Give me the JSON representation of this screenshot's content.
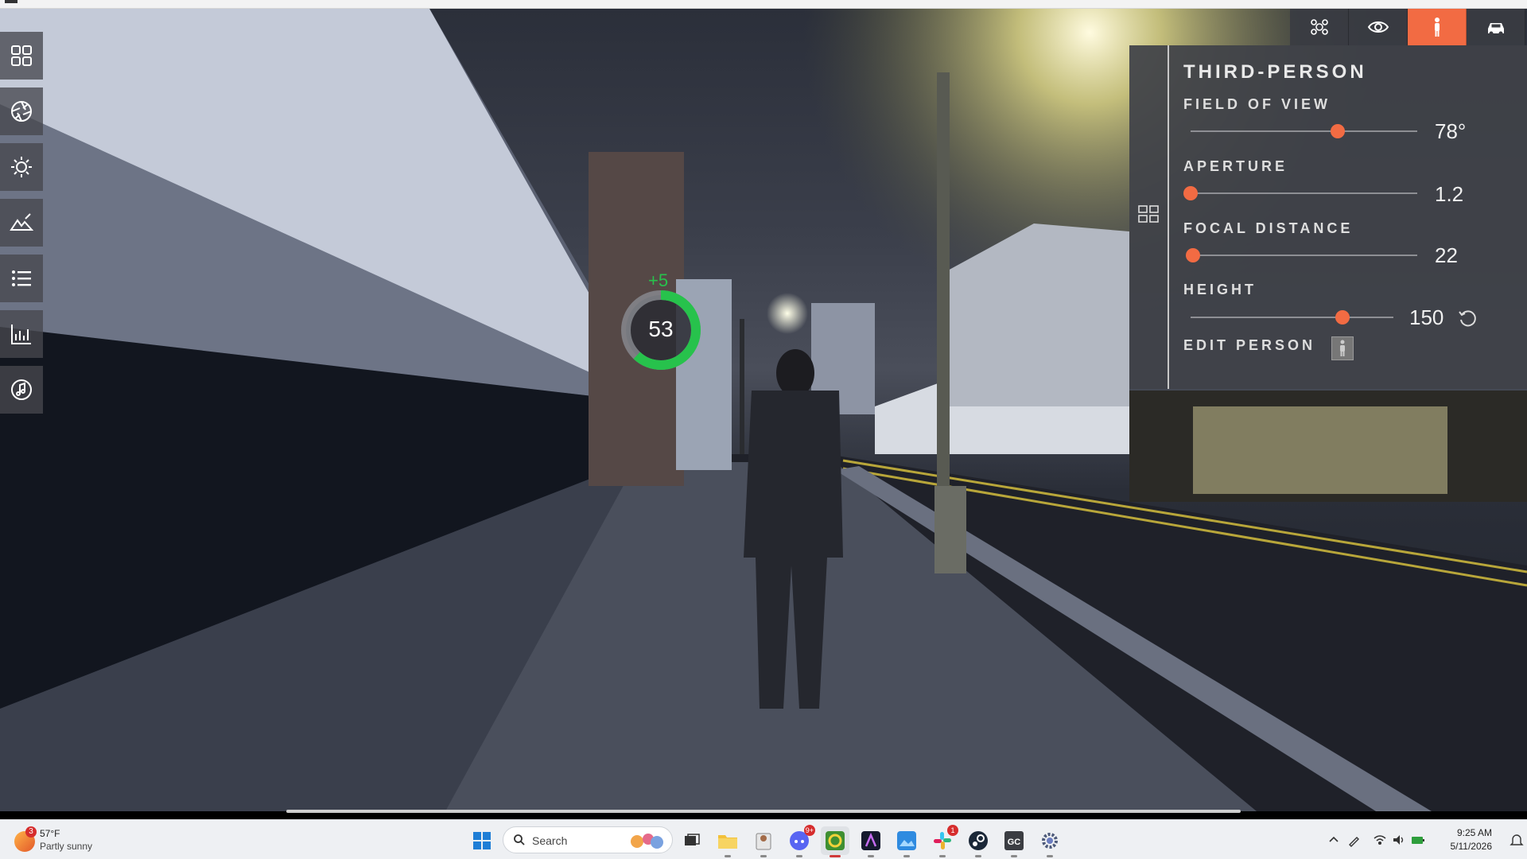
{
  "gauge": {
    "delta": "+5",
    "value": "53",
    "fraction": 0.62
  },
  "panel": {
    "title": "THIRD-PERSON",
    "rows": [
      {
        "label": "FIELD OF VIEW",
        "value": "78°",
        "level": 0.65
      },
      {
        "label": "APERTURE",
        "value": "1.2",
        "level": 0.0
      },
      {
        "label": "FOCAL DISTANCE",
        "value": "22",
        "level": 0.01
      },
      {
        "label": "HEIGHT",
        "value": "150",
        "level": 0.75
      }
    ],
    "edit_label": "EDIT PERSON"
  },
  "left_rail": [
    "grid-icon",
    "aperture-icon",
    "sun-icon",
    "terrain-icon",
    "list-icon",
    "chart-icon",
    "music-icon"
  ],
  "mode_tabs": [
    "network-icon",
    "eye-icon",
    "person-icon",
    "car-icon"
  ],
  "taskbar": {
    "weather_temp": "57°F",
    "weather_condition": "Partly sunny",
    "weather_badge": "3",
    "search_placeholder": "Search",
    "discord_badge": "9+",
    "slack_badge": "1",
    "gc_label": "GC",
    "time": "9:25 AM",
    "date": "5/11/2026"
  },
  "colors": {
    "accent": "#f26b43",
    "gauge_green": "#27c24c",
    "panel_bg": "#404248"
  }
}
